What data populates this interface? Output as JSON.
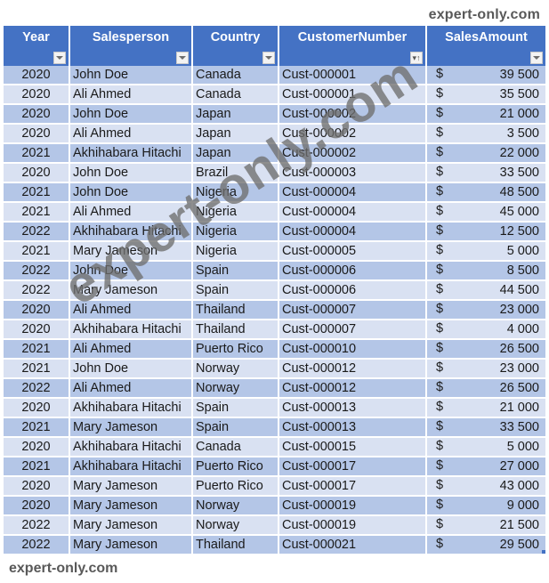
{
  "watermark": {
    "top_right": "expert-only.com",
    "bottom_left": "expert-only.com",
    "diagonal": "expert-only.com"
  },
  "table": {
    "header_color": "#4472c4",
    "band_odd_color": "#b4c6e7",
    "band_even_color": "#d9e1f2",
    "columns": [
      {
        "label": "Year",
        "filter": "filter-dropdown"
      },
      {
        "label": "Salesperson",
        "filter": "filter-dropdown"
      },
      {
        "label": "Country",
        "filter": "filter-dropdown"
      },
      {
        "label": "CustomerNumber",
        "filter": "sort-ascending-filter"
      },
      {
        "label": "SalesAmount",
        "filter": "filter-dropdown"
      }
    ],
    "currency_symbol": "$",
    "rows": [
      {
        "year": "2020",
        "salesperson": "John Doe",
        "country": "Canada",
        "customer": "Cust-000001",
        "amount": "39 500"
      },
      {
        "year": "2020",
        "salesperson": "Ali Ahmed",
        "country": "Canada",
        "customer": "Cust-000001",
        "amount": "35 500"
      },
      {
        "year": "2020",
        "salesperson": "John Doe",
        "country": "Japan",
        "customer": "Cust-000002",
        "amount": "21 000"
      },
      {
        "year": "2020",
        "salesperson": "Ali Ahmed",
        "country": "Japan",
        "customer": "Cust-000002",
        "amount": "3 500"
      },
      {
        "year": "2021",
        "salesperson": "Akhihabara Hitachi",
        "country": "Japan",
        "customer": "Cust-000002",
        "amount": "22 000"
      },
      {
        "year": "2020",
        "salesperson": "John Doe",
        "country": "Brazil",
        "customer": "Cust-000003",
        "amount": "33 500"
      },
      {
        "year": "2021",
        "salesperson": "John Doe",
        "country": "Nigeria",
        "customer": "Cust-000004",
        "amount": "48 500"
      },
      {
        "year": "2021",
        "salesperson": "Ali Ahmed",
        "country": "Nigeria",
        "customer": "Cust-000004",
        "amount": "45 000"
      },
      {
        "year": "2022",
        "salesperson": "Akhihabara Hitachi",
        "country": "Nigeria",
        "customer": "Cust-000004",
        "amount": "12 500"
      },
      {
        "year": "2021",
        "salesperson": "Mary Jameson",
        "country": "Nigeria",
        "customer": "Cust-000005",
        "amount": "5 000"
      },
      {
        "year": "2022",
        "salesperson": "John Doe",
        "country": "Spain",
        "customer": "Cust-000006",
        "amount": "8 500"
      },
      {
        "year": "2022",
        "salesperson": "Mary Jameson",
        "country": "Spain",
        "customer": "Cust-000006",
        "amount": "44 500"
      },
      {
        "year": "2020",
        "salesperson": "Ali Ahmed",
        "country": "Thailand",
        "customer": "Cust-000007",
        "amount": "23 000"
      },
      {
        "year": "2020",
        "salesperson": "Akhihabara Hitachi",
        "country": "Thailand",
        "customer": "Cust-000007",
        "amount": "4 000"
      },
      {
        "year": "2021",
        "salesperson": "Ali Ahmed",
        "country": "Puerto Rico",
        "customer": "Cust-000010",
        "amount": "26 500"
      },
      {
        "year": "2021",
        "salesperson": "John Doe",
        "country": "Norway",
        "customer": "Cust-000012",
        "amount": "23 000"
      },
      {
        "year": "2022",
        "salesperson": "Ali Ahmed",
        "country": "Norway",
        "customer": "Cust-000012",
        "amount": "26 500"
      },
      {
        "year": "2020",
        "salesperson": "Akhihabara Hitachi",
        "country": "Spain",
        "customer": "Cust-000013",
        "amount": "21 000"
      },
      {
        "year": "2021",
        "salesperson": "Mary Jameson",
        "country": "Spain",
        "customer": "Cust-000013",
        "amount": "33 500"
      },
      {
        "year": "2020",
        "salesperson": "Akhihabara Hitachi",
        "country": "Canada",
        "customer": "Cust-000015",
        "amount": "5 000"
      },
      {
        "year": "2021",
        "salesperson": "Akhihabara Hitachi",
        "country": "Puerto Rico",
        "customer": "Cust-000017",
        "amount": "27 000"
      },
      {
        "year": "2020",
        "salesperson": "Mary Jameson",
        "country": "Puerto Rico",
        "customer": "Cust-000017",
        "amount": "43 000"
      },
      {
        "year": "2020",
        "salesperson": "Mary Jameson",
        "country": "Norway",
        "customer": "Cust-000019",
        "amount": "9 000"
      },
      {
        "year": "2022",
        "salesperson": "Mary Jameson",
        "country": "Norway",
        "customer": "Cust-000019",
        "amount": "21 500"
      },
      {
        "year": "2022",
        "salesperson": "Mary Jameson",
        "country": "Thailand",
        "customer": "Cust-000021",
        "amount": "29 500"
      }
    ]
  }
}
